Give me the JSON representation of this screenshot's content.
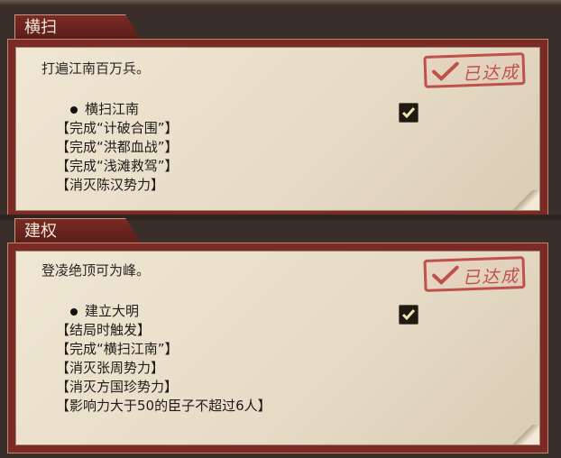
{
  "sections": [
    {
      "tab_label": "横扫",
      "description": "打遍江南百万兵。",
      "goal_title": "横扫江南",
      "requirements": [
        "【完成“计破合围”】",
        "【完成“洪都血战”】",
        "【完成“浅滩救驾”】",
        "【消灭陈汉势力】"
      ],
      "stamp_text": "已达成",
      "checked": true
    },
    {
      "tab_label": "建权",
      "description": "登凌绝顶可为峰。",
      "goal_title": "建立大明",
      "requirements": [
        "【结局时触发】",
        "【完成“横扫江南”】",
        "【消灭张周势力】",
        "【消灭方国珍势力】",
        "【影响力大于50的臣子不超过6人】"
      ],
      "stamp_text": "已达成",
      "checked": true
    }
  ],
  "colors": {
    "stamp": "#c0504a",
    "tab": "#7a2a24",
    "paper": "#e8ddc8"
  }
}
